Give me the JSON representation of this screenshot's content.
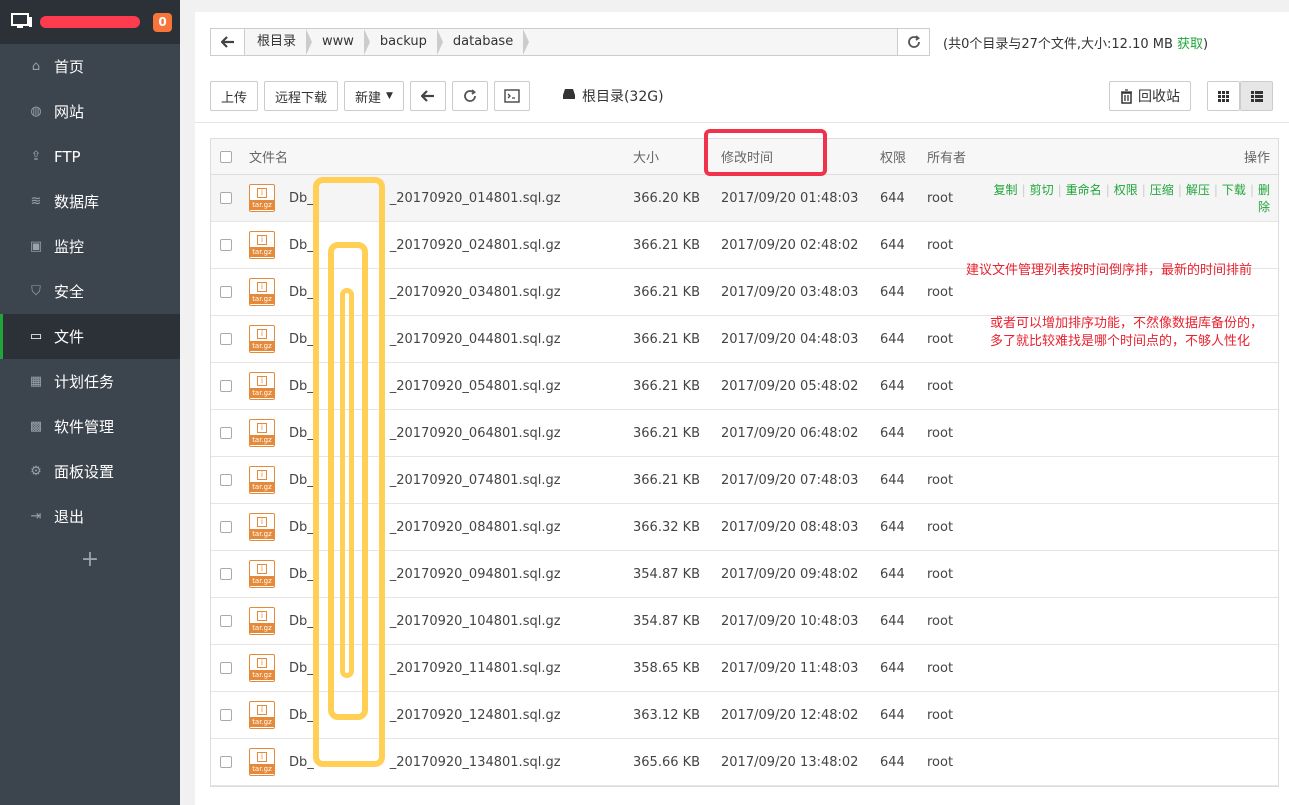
{
  "sidebar": {
    "badge": "0",
    "items": [
      {
        "label": "首页",
        "icon": "home-icon"
      },
      {
        "label": "网站",
        "icon": "globe-icon"
      },
      {
        "label": "FTP",
        "icon": "ftp-icon"
      },
      {
        "label": "数据库",
        "icon": "database-icon"
      },
      {
        "label": "监控",
        "icon": "monitor-icon"
      },
      {
        "label": "安全",
        "icon": "shield-icon"
      },
      {
        "label": "文件",
        "icon": "folder-icon"
      },
      {
        "label": "计划任务",
        "icon": "calendar-icon"
      },
      {
        "label": "软件管理",
        "icon": "grid-icon"
      },
      {
        "label": "面板设置",
        "icon": "gear-icon"
      },
      {
        "label": "退出",
        "icon": "logout-icon"
      }
    ],
    "add": "+"
  },
  "path": {
    "crumbs": [
      "根目录",
      "www",
      "backup",
      "database"
    ],
    "info_prefix": "(共0个目录与27个文件,大小:12.10 MB ",
    "info_fetch": "获取",
    "info_suffix": ")"
  },
  "toolbar": {
    "upload": "上传",
    "remote_download": "远程下载",
    "new": "新建",
    "disk": "根目录(32G)",
    "recycle": "回收站"
  },
  "table": {
    "headers": {
      "name": "文件名",
      "size": "大小",
      "time": "修改时间",
      "perm": "权限",
      "owner": "所有者",
      "ops": "操作"
    },
    "ops": [
      "复制",
      "剪切",
      "重命名",
      "权限",
      "压缩",
      "解压",
      "下载",
      "删除"
    ],
    "rows": [
      {
        "name": "Db_",
        "suffix": "_20170920_014801.sql.gz",
        "size": "366.20 KB",
        "time": "2017/09/20 01:48:03",
        "perm": "644",
        "owner": "root"
      },
      {
        "name": "Db_",
        "suffix": "_20170920_024801.sql.gz",
        "size": "366.21 KB",
        "time": "2017/09/20 02:48:02",
        "perm": "644",
        "owner": "root"
      },
      {
        "name": "Db_",
        "suffix": "_20170920_034801.sql.gz",
        "size": "366.21 KB",
        "time": "2017/09/20 03:48:03",
        "perm": "644",
        "owner": "root"
      },
      {
        "name": "Db_",
        "suffix": "_20170920_044801.sql.gz",
        "size": "366.21 KB",
        "time": "2017/09/20 04:48:03",
        "perm": "644",
        "owner": "root"
      },
      {
        "name": "Db_",
        "suffix": "_20170920_054801.sql.gz",
        "size": "366.21 KB",
        "time": "2017/09/20 05:48:02",
        "perm": "644",
        "owner": "root"
      },
      {
        "name": "Db_",
        "suffix": "_20170920_064801.sql.gz",
        "size": "366.21 KB",
        "time": "2017/09/20 06:48:02",
        "perm": "644",
        "owner": "root"
      },
      {
        "name": "Db_",
        "suffix": "_20170920_074801.sql.gz",
        "size": "366.21 KB",
        "time": "2017/09/20 07:48:03",
        "perm": "644",
        "owner": "root"
      },
      {
        "name": "Db_",
        "suffix": "_20170920_084801.sql.gz",
        "size": "366.32 KB",
        "time": "2017/09/20 08:48:03",
        "perm": "644",
        "owner": "root"
      },
      {
        "name": "Db_",
        "suffix": "_20170920_094801.sql.gz",
        "size": "354.87 KB",
        "time": "2017/09/20 09:48:02",
        "perm": "644",
        "owner": "root"
      },
      {
        "name": "Db_",
        "suffix": "_20170920_104801.sql.gz",
        "size": "354.87 KB",
        "time": "2017/09/20 10:48:03",
        "perm": "644",
        "owner": "root"
      },
      {
        "name": "Db_",
        "suffix": "_20170920_114801.sql.gz",
        "size": "358.65 KB",
        "time": "2017/09/20 11:48:03",
        "perm": "644",
        "owner": "root"
      },
      {
        "name": "Db_",
        "suffix": "_20170920_124801.sql.gz",
        "size": "363.12 KB",
        "time": "2017/09/20 12:48:02",
        "perm": "644",
        "owner": "root"
      },
      {
        "name": "Db_",
        "suffix": "_20170920_134801.sql.gz",
        "size": "365.66 KB",
        "time": "2017/09/20 13:48:02",
        "perm": "644",
        "owner": "root"
      }
    ]
  },
  "notes": {
    "n1": "建议文件管理列表按时间倒序排，最新的时间排前",
    "n2": "或者可以增加排序功能，不然像数据库备份的，",
    "n3": "多了就比较难找是哪个时间点的，不够人性化"
  },
  "colors": {
    "accent": "#20a53a",
    "sidebar": "#3c444d",
    "annotation_red": "#e8222f",
    "highlight_yellow": "#ffcc4d"
  }
}
